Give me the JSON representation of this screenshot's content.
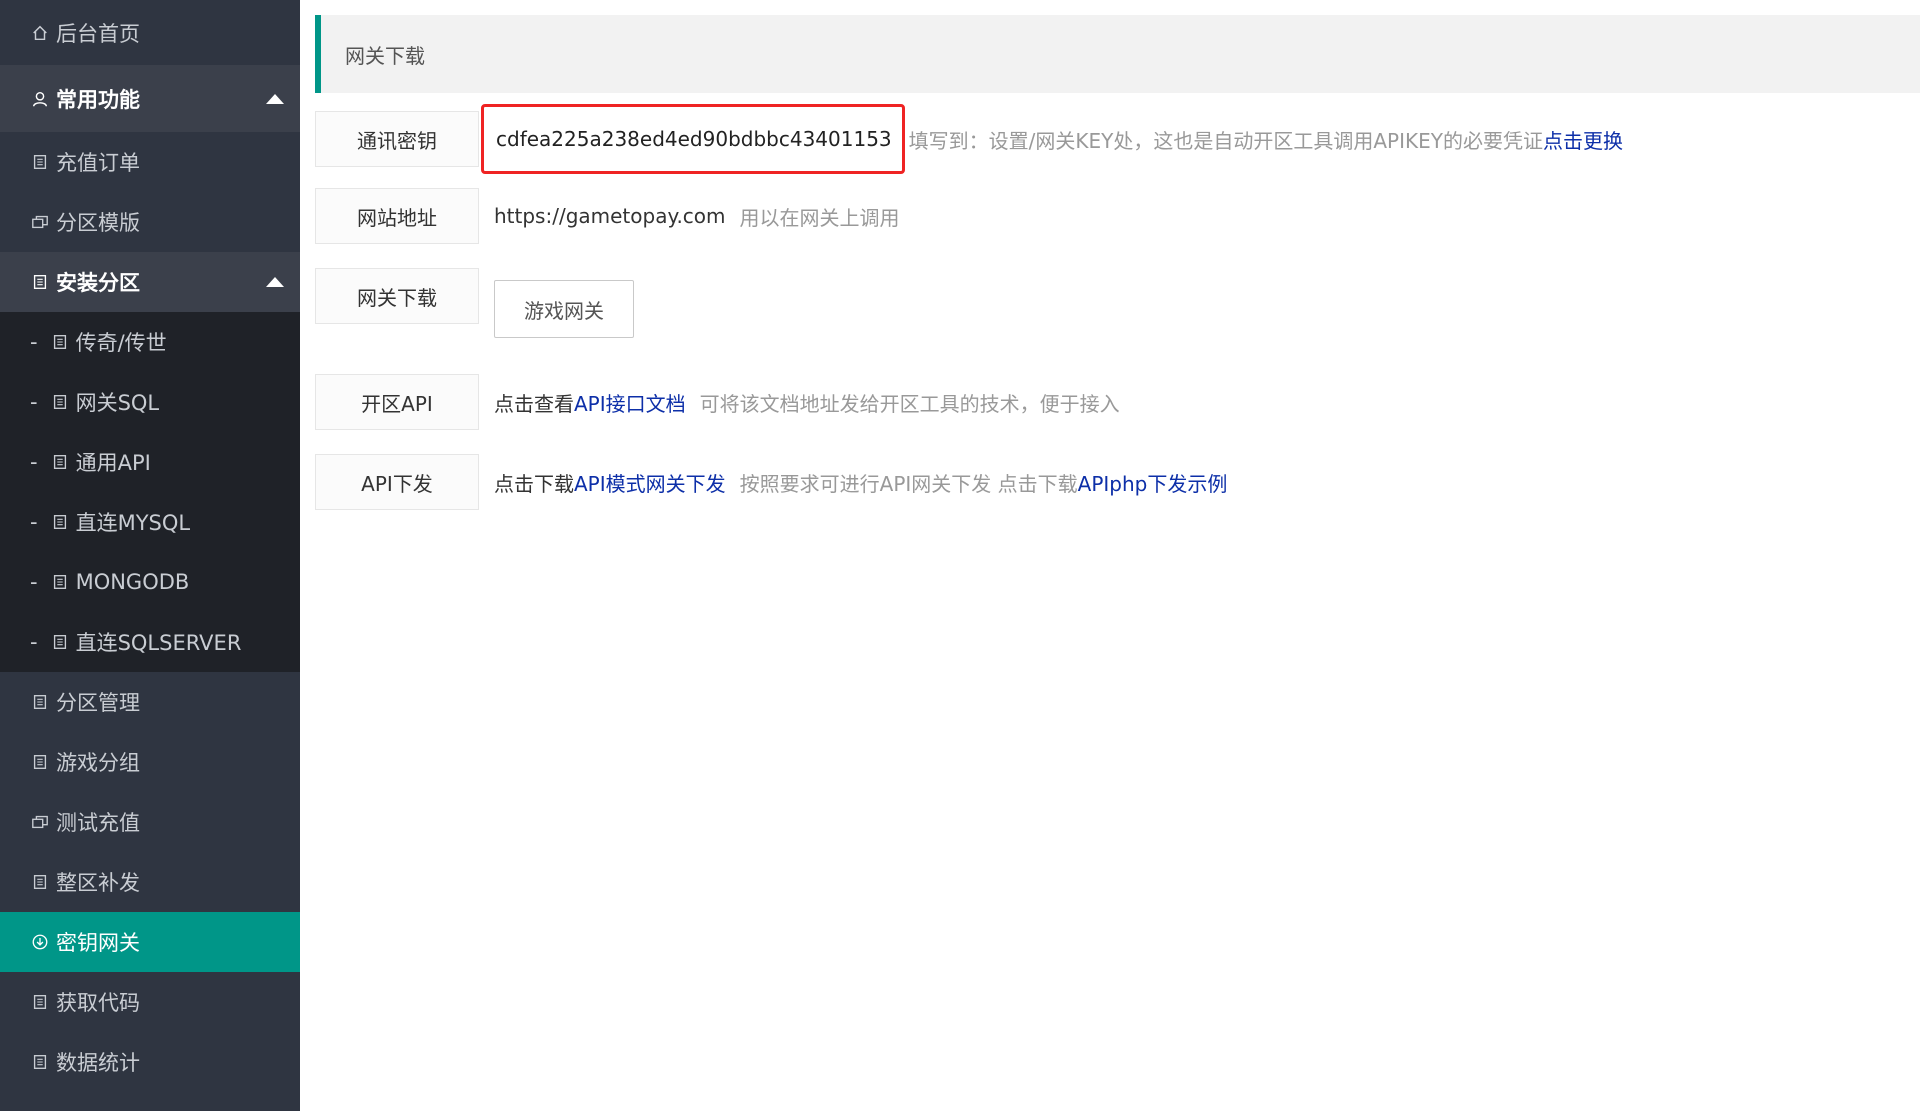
{
  "sidebar": {
    "home": "后台首页",
    "group_common": "常用功能",
    "recharge_orders": "充值订单",
    "zone_templates": "分区模版",
    "group_install": "安装分区",
    "sub_items": [
      {
        "dash": "-",
        "label": "传奇/传世"
      },
      {
        "dash": "-",
        "label": "网关SQL"
      },
      {
        "dash": "-",
        "label": "通用API"
      },
      {
        "dash": "-",
        "label": "直连MYSQL"
      },
      {
        "dash": "-",
        "label": "MONGODB"
      },
      {
        "dash": "-",
        "label": "直连SQLSERVER"
      }
    ],
    "zone_manage": "分区管理",
    "game_group": "游戏分组",
    "test_recharge": "测试充值",
    "full_reissue": "整区补发",
    "key_gateway": "密钥网关",
    "get_code": "获取代码",
    "data_stats": "数据统计"
  },
  "header": {
    "title": "网关下载"
  },
  "rows": {
    "secret": {
      "label": "通讯密钥",
      "key": "cdfea225a238ed4ed90bdbbc43401153",
      "hint": "填写到：设置/网关KEY处，这也是自动开区工具调用APIKEY的必要凭证",
      "link": "点击更换"
    },
    "site": {
      "label": "网站地址",
      "url": "https://gametopay.com",
      "hint": "用以在网关上调用"
    },
    "gateway": {
      "label": "网关下载",
      "button": "游戏网关"
    },
    "api": {
      "label": "开区API",
      "prefix": "点击查看",
      "link": "API接口文档",
      "hint": "可将该文档地址发给开区工具的技术，便于接入"
    },
    "api_push": {
      "label": "API下发",
      "prefix": "点击下载",
      "link": "API模式网关下发",
      "hint": "按照要求可进行API网关下发 点击下载",
      "link2": "APIphp下发示例"
    }
  },
  "colors": {
    "accent": "#009688",
    "sidebar": "#2f3541",
    "link": "#0d2fa8",
    "highlight": "#ef2323"
  }
}
